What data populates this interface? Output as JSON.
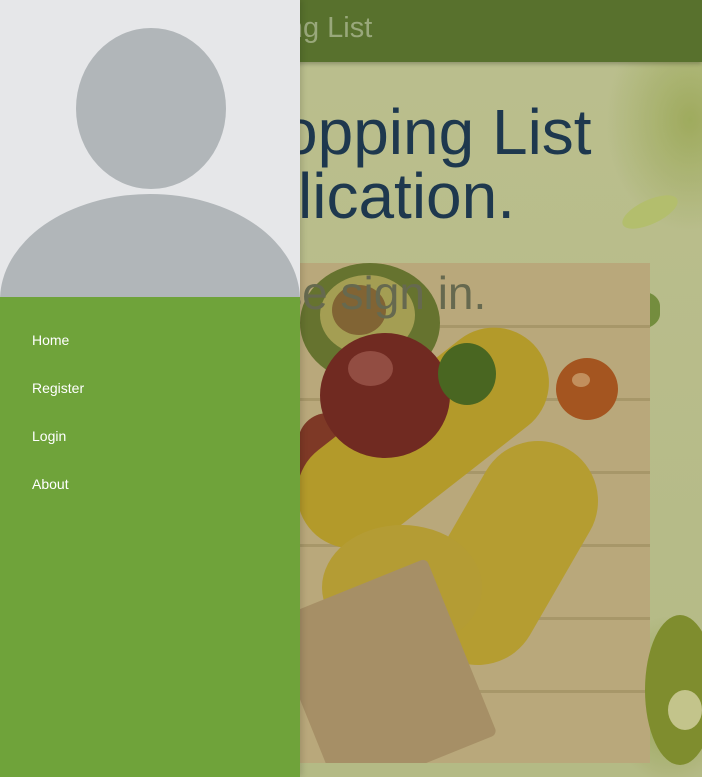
{
  "app_bar": {
    "title": "opping List"
  },
  "hero": {
    "title_line1": "opping List",
    "title_line2": "lication.",
    "subtitle": "ease sign in."
  },
  "drawer": {
    "nav_items": [
      {
        "label": "Home"
      },
      {
        "label": "Register"
      },
      {
        "label": "Login"
      },
      {
        "label": "About"
      }
    ]
  },
  "colors": {
    "drawer_green": "#6fa33a",
    "header_gray": "#e6e7e9",
    "avatar_gray": "#b1b6b9",
    "title_navy": "#1d3a57",
    "app_bar_green": "#5f7a32"
  },
  "icons": {
    "avatar": "default-user-avatar-icon"
  }
}
